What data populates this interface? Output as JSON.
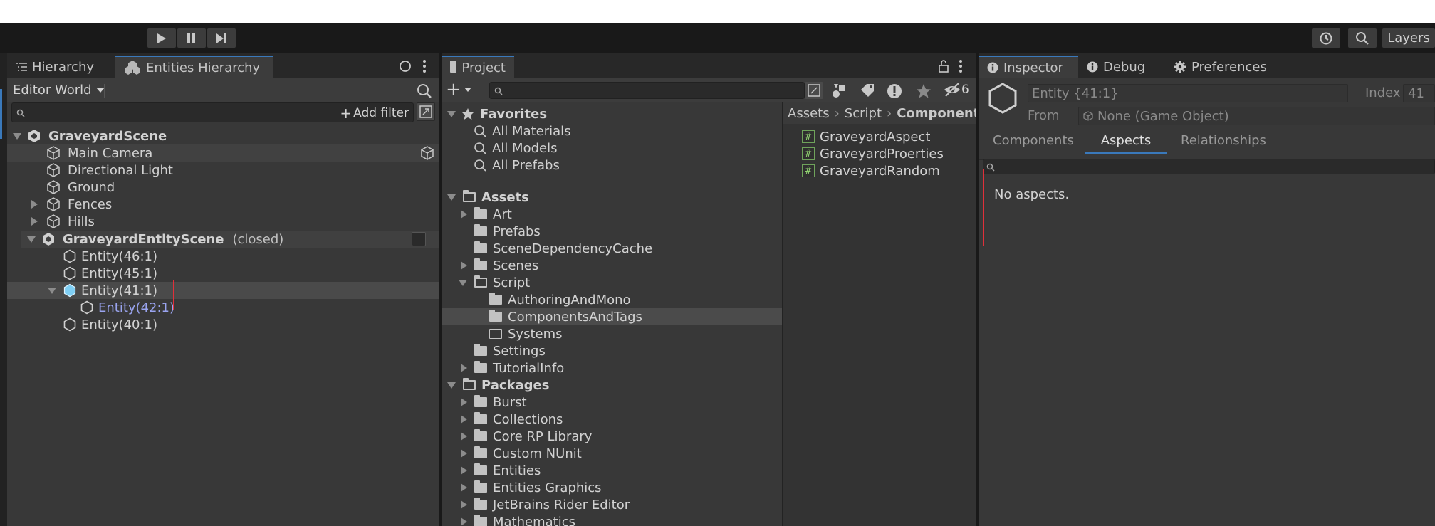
{
  "toolbar": {
    "play_icon": "play-icon",
    "pause_icon": "pause-icon",
    "step_icon": "step-icon",
    "history_icon": "history-icon",
    "search_icon": "search-icon",
    "layers_label": "Layers"
  },
  "hierarchy_panel": {
    "tabs": [
      {
        "label": "Hierarchy",
        "icon": "list-icon"
      },
      {
        "label": "Entities Hierarchy",
        "icon": "entities-icon"
      }
    ],
    "world_dropdown": "Editor World",
    "add_filter_label": "Add filter",
    "items": [
      {
        "label": "GraveyardScene",
        "bold": true
      },
      {
        "label": "Main Camera"
      },
      {
        "label": "Directional Light"
      },
      {
        "label": "Ground"
      },
      {
        "label": "Fences"
      },
      {
        "label": "Hills"
      },
      {
        "label": "GraveyardEntityScene",
        "suffix": "(closed)",
        "bold": true
      },
      {
        "label": "Entity(46:1)"
      },
      {
        "label": "Entity(45:1)"
      },
      {
        "label": "Entity(41:1)"
      },
      {
        "label": "Entity(42:1)"
      },
      {
        "label": "Entity(40:1)"
      }
    ]
  },
  "project_panel": {
    "tab_label": "Project",
    "hidden_count": "6",
    "favorites": {
      "label": "Favorites",
      "items": [
        "All Materials",
        "All Models",
        "All Prefabs"
      ]
    },
    "assets": {
      "label": "Assets",
      "items": [
        "Art",
        "Prefabs",
        "SceneDependencyCache",
        "Scenes",
        "Script",
        "AuthoringAndMono",
        "ComponentsAndTags",
        "Systems",
        "Settings",
        "TutorialInfo"
      ]
    },
    "packages": {
      "label": "Packages",
      "items": [
        "Burst",
        "Collections",
        "Core RP Library",
        "Custom NUnit",
        "Entities",
        "Entities Graphics",
        "JetBrains Rider Editor",
        "Mathematics"
      ]
    },
    "breadcrumb": [
      "Assets",
      "Script",
      "Component"
    ],
    "files": [
      "GraveyardAspect",
      "GraveyardProerties",
      "GraveyardRandom"
    ]
  },
  "inspector_panel": {
    "tabs": [
      {
        "label": "Inspector",
        "icon": "info-icon"
      },
      {
        "label": "Debug",
        "icon": "info-icon"
      },
      {
        "label": "Preferences",
        "icon": "gear-icon"
      }
    ],
    "entity_name": "Entity {41:1}",
    "index_label": "Index",
    "index_value": "41",
    "from_label": "From",
    "from_value": "None (Game Object)",
    "sub_tabs": [
      "Components",
      "Aspects",
      "Relationships"
    ],
    "active_sub_tab": "Aspects",
    "empty_message": "No aspects."
  },
  "colors": {
    "accent": "#3a79bb",
    "selection": "#4b4b4b",
    "highlight_box": "#e0303a",
    "entity_selected": "#7fcff4",
    "child_link": "#9aa4f0"
  }
}
